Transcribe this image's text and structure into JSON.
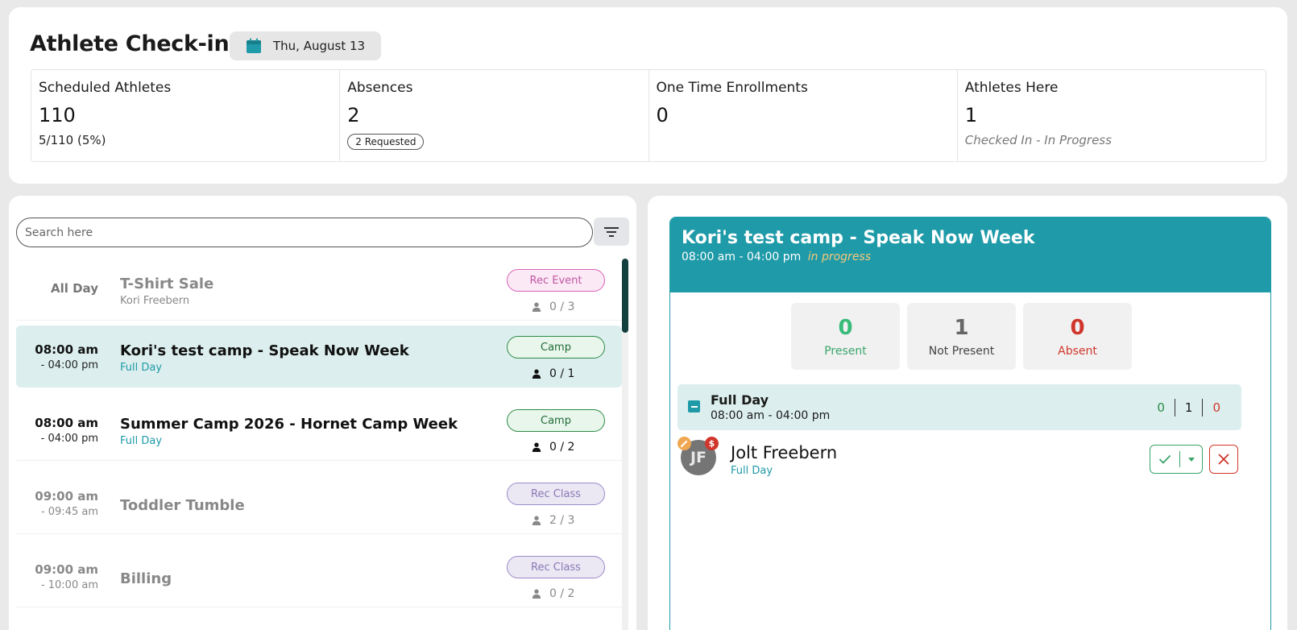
{
  "header": {
    "title": "Athlete Check-in",
    "date": "Thu, August 13"
  },
  "stats": [
    {
      "label": "Scheduled Athletes",
      "value": "110",
      "sub": "5/110 (5%)"
    },
    {
      "label": "Absences",
      "value": "2",
      "badge": "2 Requested"
    },
    {
      "label": "One Time Enrollments",
      "value": "0"
    },
    {
      "label": "Athletes Here",
      "value": "1",
      "sub": "Checked In - In Progress"
    }
  ],
  "search": {
    "placeholder": "Search here"
  },
  "events": [
    {
      "time_label": "All Day",
      "title": "T-Shirt Sale",
      "sub": "Kori Freebern",
      "badge": "Rec Event",
      "count": "0 / 3"
    },
    {
      "start": "08:00 am",
      "end": "- 04:00 pm",
      "title": "Kori's test camp - Speak Now Week",
      "sub": "Full Day",
      "badge": "Camp",
      "count": "0 / 1"
    },
    {
      "start": "08:00 am",
      "end": "- 04:00 pm",
      "title": "Summer Camp 2026 - Hornet Camp Week",
      "sub": "Full Day",
      "badge": "Camp",
      "count": "0 / 2"
    },
    {
      "start": "09:00 am",
      "end": "- 09:45 am",
      "title": "Toddler Tumble",
      "badge": "Rec Class",
      "count": "2 / 3"
    },
    {
      "start": "09:00 am",
      "end": "- 10:00 am",
      "title": "Billing",
      "badge": "Rec Class",
      "count": "0 / 2"
    }
  ],
  "detail": {
    "title": "Kori's test camp - Speak Now Week",
    "time": "08:00 am  -  04:00 pm",
    "status": "in progress",
    "tiles": [
      {
        "value": "0",
        "label": "Present"
      },
      {
        "value": "1",
        "label": "Not Present"
      },
      {
        "value": "0",
        "label": "Absent"
      }
    ],
    "group": {
      "name": "Full Day",
      "time": "08:00 am - 04:00 pm",
      "present": "0",
      "not_present": "1",
      "absent": "0"
    },
    "athlete": {
      "initials": "JF",
      "name": "Jolt Freebern",
      "sub": "Full Day",
      "badge_dollar": "$"
    }
  },
  "colors": {
    "teal": "#1f9aa8",
    "present": "#39bb7a",
    "absent": "#d0362b",
    "camp": "#2d8a46"
  }
}
